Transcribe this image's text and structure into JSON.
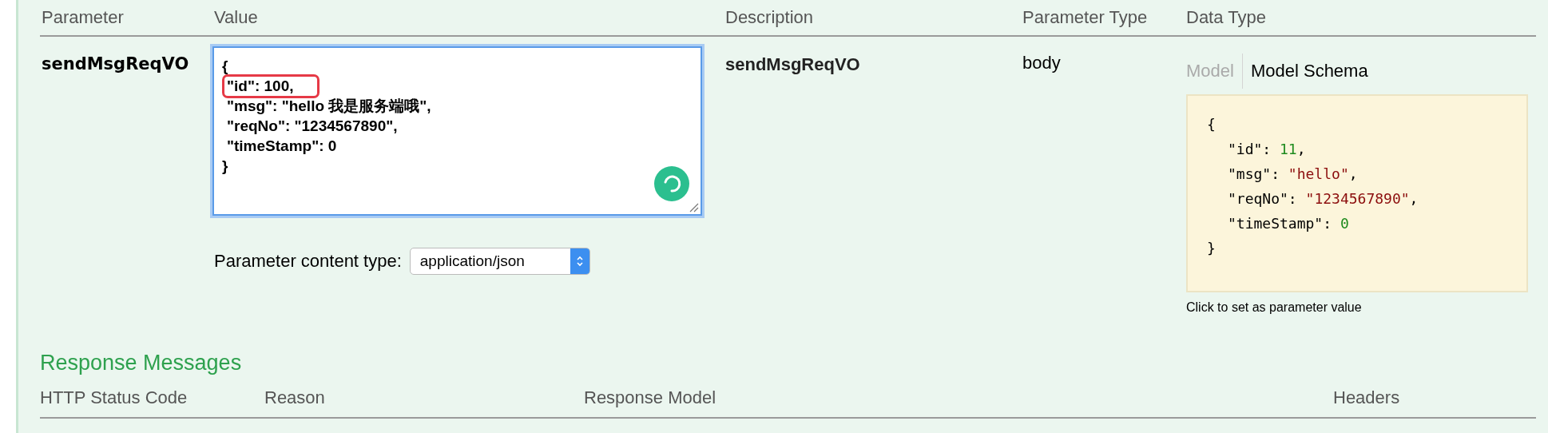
{
  "parameters_table": {
    "columns": [
      "Parameter",
      "Value",
      "Description",
      "Parameter Type",
      "Data Type"
    ],
    "rows": [
      {
        "parameter": "sendMsgReqVO",
        "value": {
          "lines": [
            {
              "text": "{",
              "highlighted": false
            },
            {
              "text": "\"id\": 100,",
              "highlighted": true
            },
            {
              "text": "\"msg\": \"hello 我是服务端哦\",",
              "highlighted": false
            },
            {
              "text": "\"reqNo\": \"1234567890\",",
              "highlighted": false
            },
            {
              "text": "\"timeStamp\": 0",
              "highlighted": false
            },
            {
              "text": "}",
              "highlighted": false
            }
          ]
        },
        "content_type": {
          "label": "Parameter content type:",
          "value": "application/json"
        },
        "description": "sendMsgReqVO",
        "parameter_type": "body",
        "data_type": {
          "tabs": [
            {
              "label": "Model",
              "selected": false
            },
            {
              "label": "Model Schema",
              "selected": true
            }
          ],
          "schema_lines": [
            {
              "parts": [
                {
                  "text": "{"
                }
              ]
            },
            {
              "parts": [
                {
                  "text": "\"id\": "
                },
                {
                  "text": "11",
                  "kind": "number"
                },
                {
                  "text": ","
                }
              ]
            },
            {
              "parts": [
                {
                  "text": "\"msg\": "
                },
                {
                  "text": "\"hello\"",
                  "kind": "string"
                },
                {
                  "text": ","
                }
              ]
            },
            {
              "parts": [
                {
                  "text": "\"reqNo\": "
                },
                {
                  "text": "\"1234567890\"",
                  "kind": "string"
                },
                {
                  "text": ","
                }
              ]
            },
            {
              "parts": [
                {
                  "text": "\"timeStamp\": "
                },
                {
                  "text": "0",
                  "kind": "number"
                }
              ]
            },
            {
              "parts": [
                {
                  "text": "}"
                }
              ]
            }
          ],
          "hint": "Click to set as parameter value"
        }
      }
    ]
  },
  "response_messages": {
    "title": "Response Messages",
    "columns": [
      "HTTP Status Code",
      "Reason",
      "Response Model",
      "Headers"
    ]
  }
}
